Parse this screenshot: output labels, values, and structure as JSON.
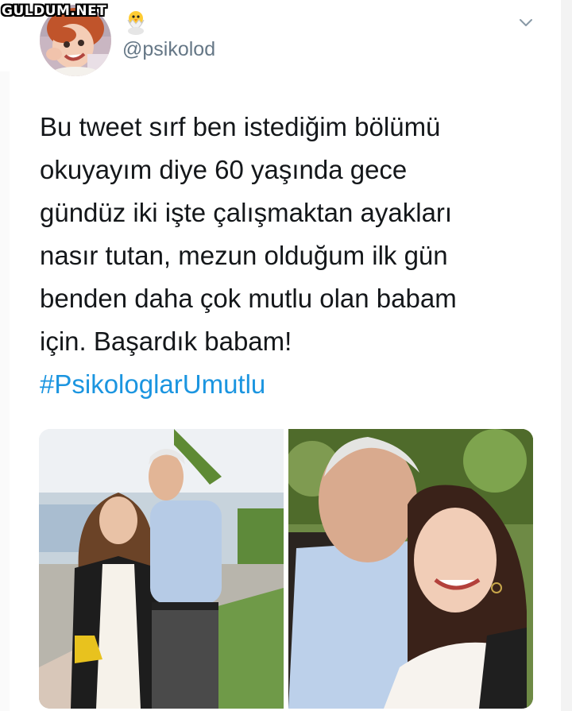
{
  "watermark": "GULDUM.NET",
  "profile": {
    "handle": "@psikolod",
    "emoji_icon": "hatching-chick-icon",
    "avatar_icon": "child-avatar-photo"
  },
  "tweet": {
    "lines": [
      "Bu tweet sırf ben istediğim bölümü",
      "okuyayım diye 60 yaşında gece",
      "gündüz iki işte çalışmaktan ayakları",
      "nasır tutan, mezun olduğum ilk gün",
      "benden daha çok mutlu olan babam",
      "için. Başardık babam!"
    ],
    "hashtag": "#PsikologlarUmutlu"
  },
  "menu": {
    "icon": "chevron-down-icon"
  },
  "colors": {
    "hashtag": "#1b95e0",
    "handle": "#657786",
    "text": "#14171a"
  }
}
